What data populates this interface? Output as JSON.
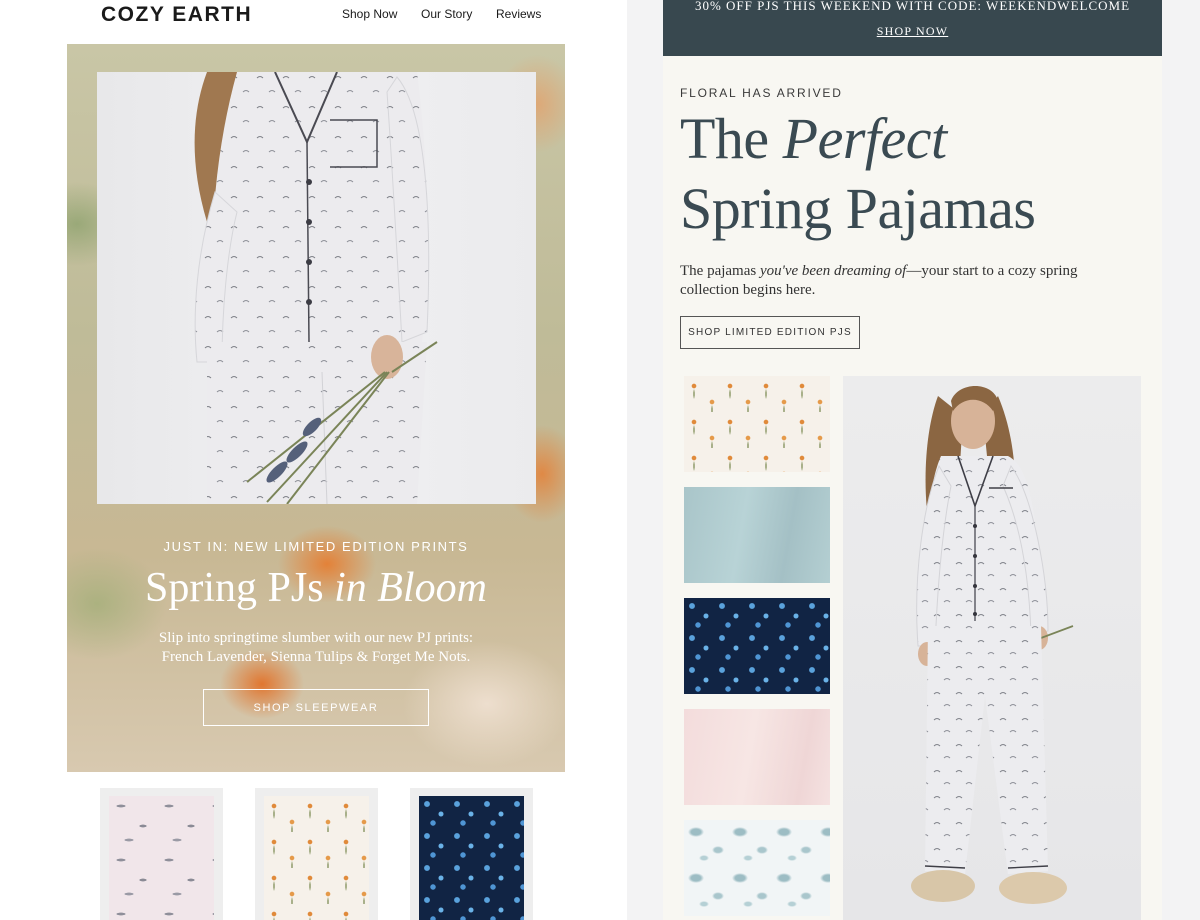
{
  "left_email": {
    "header": {
      "logo": "COZY EARTH",
      "nav": [
        "Shop Now",
        "Our Story",
        "Reviews"
      ]
    },
    "hero": {
      "kicker": "JUST IN: NEW LIMITED EDITION PRINTS",
      "title_main": "Spring PJs ",
      "title_italic": "in Bloom",
      "body_line1": "Slip into springtime slumber with our new PJ prints:",
      "body_line2": "French Lavender, Sienna Tulips & Forget Me Nots.",
      "cta": "SHOP SLEEPWEAR"
    },
    "swatches": [
      "french-lavender-print",
      "sienna-tulips-print",
      "forget-me-nots-print"
    ]
  },
  "right_email": {
    "promo": {
      "text": "30% OFF PJS THIS WEEKEND WITH CODE: WEEKENDWELCOME",
      "link": "SHOP NOW"
    },
    "kicker": "FLORAL HAS ARRIVED",
    "headline_line1_main": "The ",
    "headline_line1_italic": "Perfect",
    "headline_line2": "Spring Pajamas",
    "body_pre": "The pajamas ",
    "body_italic": "you've been dreaming of",
    "body_post": "—your start to a cozy spring collection begins here.",
    "cta": "SHOP LIMITED EDITION PJS",
    "fabric_swatches": [
      "tulip-print",
      "sage",
      "forget-me-not-print",
      "blush",
      "blue-toile-print"
    ]
  },
  "colors": {
    "promo_bar": "#38484f",
    "headline": "#3a4a52",
    "panel_bg": "#f8f7f2",
    "hero_overlay_text": "#ffffff"
  }
}
